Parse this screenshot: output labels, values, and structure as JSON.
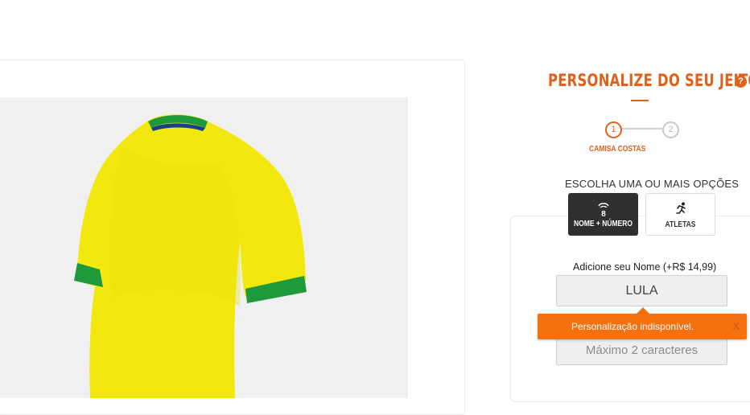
{
  "product": {
    "image_icon": "shirt-image",
    "colors": {
      "shirt": "#f3e80e",
      "collar": "#1e9a3c",
      "collar_inner": "#1b3f8f"
    }
  },
  "customize": {
    "title": "PERSONALIZE DO SEU JEITO",
    "help_icon": "?",
    "steps": [
      "1",
      "2"
    ],
    "active_step_label": "CAMISA COSTAS",
    "options_heading": "ESCOLHA UMA OU MAIS OPÇÕES",
    "options": [
      {
        "label": "NOME + NÚMERO",
        "icon": "jersey-number-icon",
        "glyph": "8",
        "selected": true
      },
      {
        "label": "ATLETAS",
        "icon": "running-athlete-icon",
        "glyph": "🏃",
        "selected": false
      }
    ],
    "name_label": "Adicione seu Nome (+R$ 14,99)",
    "name_value": "LULA",
    "number_placeholder": "Máximo 2 caracteres"
  },
  "toast": {
    "message": "Personalização indisponível.",
    "close": "X"
  },
  "colors": {
    "accent": "#e0611b",
    "toast": "#f5700f",
    "dark_button": "#2f2f2f"
  }
}
